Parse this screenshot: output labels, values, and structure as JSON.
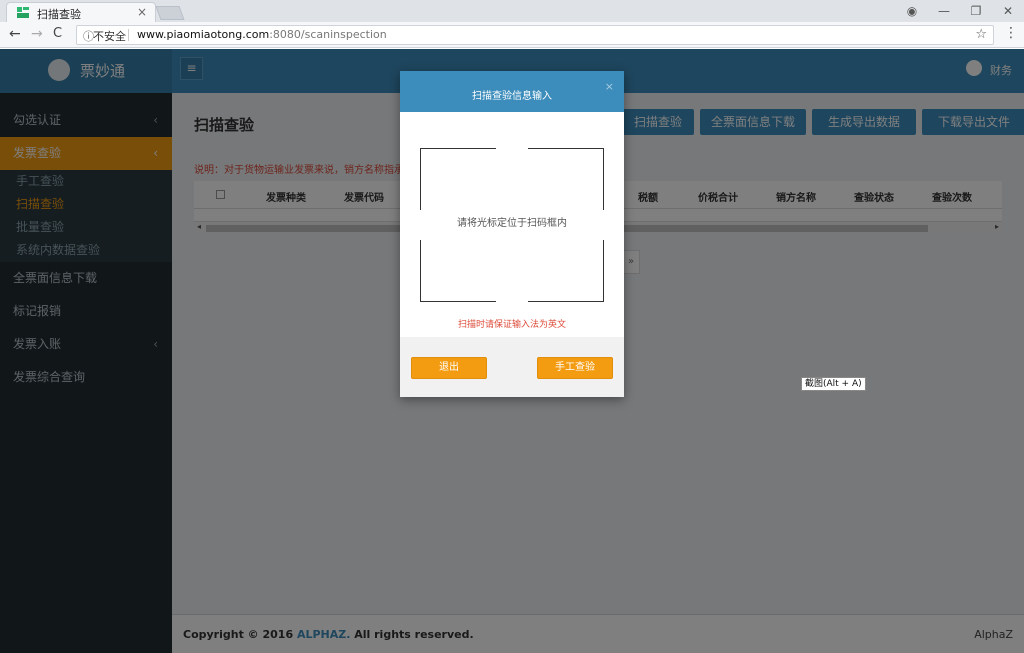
{
  "browser": {
    "tab_title": "扫描查验",
    "tab_close": "×",
    "window_controls": [
      "◉",
      "—",
      "❐",
      "✕"
    ],
    "back": "←",
    "forward": "→",
    "reload": "C",
    "security_icon": "ⓘ",
    "security_label": "不安全",
    "url_domain": "www.piaomiaotong.com",
    "url_rest": ":8080/scaninspection",
    "star": "☆",
    "menu": "⋮"
  },
  "app": {
    "brand": "票妙通",
    "user": "财务",
    "hamburger": "≡",
    "page_title": "扫描查验",
    "sidebar": [
      {
        "label": "勾选认证",
        "chevron": "‹"
      },
      {
        "label": "发票查验",
        "chevron": "‹",
        "active": true,
        "children": [
          {
            "label": "手工查验"
          },
          {
            "label": "扫描查验",
            "active": true
          },
          {
            "label": "批量查验"
          },
          {
            "label": "系统内数据查验"
          }
        ]
      },
      {
        "label": "全票面信息下载",
        "chevron": ""
      },
      {
        "label": "标记报销",
        "chevron": ""
      },
      {
        "label": "发票入账",
        "chevron": "‹"
      },
      {
        "label": "发票综合查询",
        "chevron": ""
      }
    ],
    "actions": [
      "扫描查验",
      "全票面信息下载",
      "生成导出数据",
      "下载导出文件"
    ],
    "note": "说明：对于货物运输业发票来说，销方名称指承运人",
    "table_headers": [
      "发票种类",
      "发票代码",
      "税额",
      "价税合计",
      "销方名称",
      "查验状态",
      "查验次数"
    ],
    "scroll_left": "◂",
    "scroll_right": "▸",
    "pager_next": "»",
    "footer_prefix": "Copyright © 2016 ",
    "footer_brand": "ALPHAZ.",
    "footer_suffix": " All rights reserved.",
    "footer_right": "AlphaZ"
  },
  "modal": {
    "title": "扫描查验信息输入",
    "close": "×",
    "instruction": "请将光标定位于扫码框内",
    "warning": "扫描时请保证输入法为英文",
    "exit_label": "退出",
    "manual_label": "手工查验"
  },
  "tooltip": "截图(Alt + A)",
  "colors": {
    "primary": "#3c8dbc",
    "sidebar_bg": "#222d32",
    "active_orange": "#f39c12",
    "warning_red": "#dd4b39"
  }
}
